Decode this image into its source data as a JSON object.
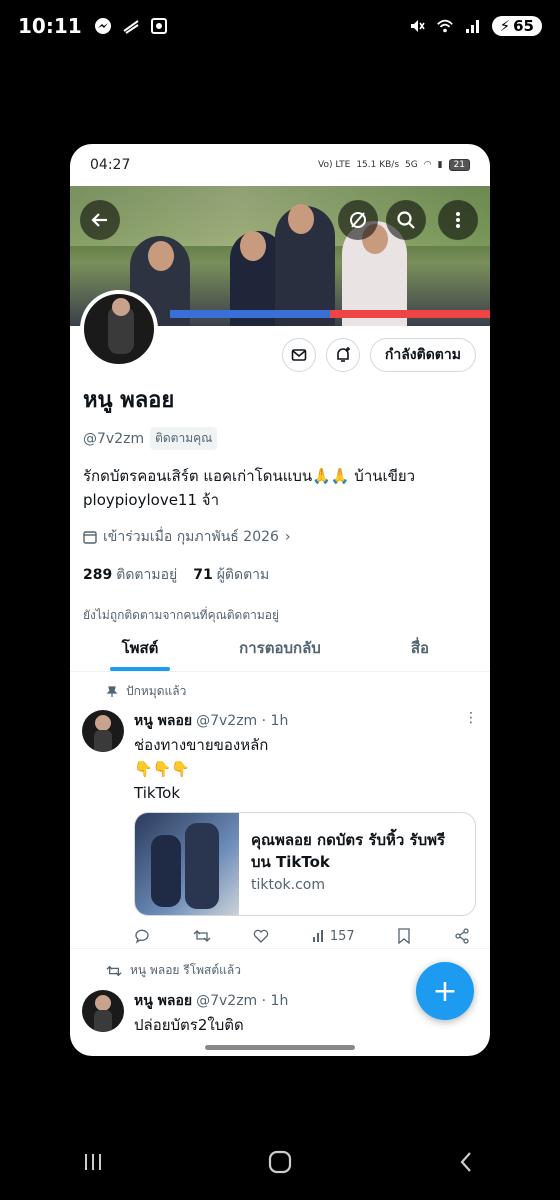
{
  "os": {
    "time": "10:11",
    "battery": "65"
  },
  "inner_status": {
    "time": "04:27",
    "net": "Vo) LTE",
    "speed": "15.1 KB/s",
    "sig": "5G",
    "battery": "21"
  },
  "profile": {
    "name": "หนู พลอย",
    "handle": "@7v2zm",
    "follows_you": "ติดตามคุณ",
    "bio": "รักดบัตรคอนเสิร์ต แอคเก่าโดนแบน🙏🙏 บ้านเขียว ploypioylove11 จ้า",
    "joined": "เข้าร่วมเมื่อ กุมภาพันธ์ 2026",
    "following_count": "289",
    "following_label": "ติดตามอยู่",
    "followers_count": "71",
    "followers_label": "ผู้ติดตาม",
    "not_followed": "ยังไม่ถูกติดตามจากคนที่คุณติดตามอยู่",
    "follow_button": "กำลังติดตาม"
  },
  "tabs": [
    "โพสต์",
    "การตอบกลับ",
    "สื่อ"
  ],
  "pinned_label": "ปักหมุดแล้ว",
  "post1": {
    "name": "หนู พลอย",
    "handle": "@7v2zm · 1h",
    "line1": "ช่องทางขายของหลัก",
    "line2": "👇👇👇",
    "line3": "TikTok",
    "card_title": "คุณพลอย กดบัตร รับหิ้ว รับพรี บน TikTok",
    "card_domain": "tiktok.com",
    "views": "157"
  },
  "repost_label": "หนู พลอย รีโพสต์แล้ว",
  "post2": {
    "name": "หนู พลอย",
    "handle": "@7v2zm · 1h",
    "line1": "ปล่อยบัตร2ใบติด"
  },
  "accent": "#1d9bf0"
}
